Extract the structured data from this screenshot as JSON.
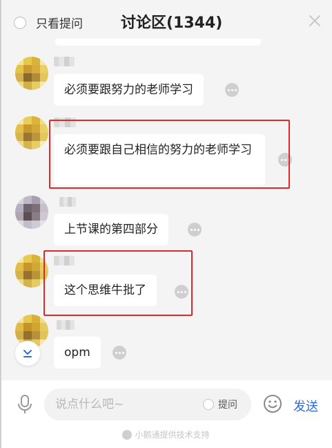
{
  "header": {
    "only_questions_label": "只看提问",
    "title": "讨论区(1344)"
  },
  "messages": [
    {
      "text": "必须要跟努力的老师学习",
      "highlighted": false
    },
    {
      "text": "必须要跟自己相信的努力的老师学习",
      "highlighted": true
    },
    {
      "text": "上节课的第四部分",
      "highlighted": false
    },
    {
      "text": "这个思维牛批了",
      "highlighted": true
    },
    {
      "text": "opm",
      "highlighted": false
    }
  ],
  "composer": {
    "placeholder": "说点什么吧~",
    "ask_label": "提问",
    "send_label": "发送"
  },
  "footer": {
    "support_text": "小鹅通提供技术支持"
  },
  "colors": {
    "accent": "#2d6bd6",
    "highlight_border": "#e02626",
    "background": "#f4f4f4"
  },
  "icons": [
    "close-icon",
    "microphone-icon",
    "emoji-icon",
    "scroll-down-icon",
    "more-icon"
  ]
}
